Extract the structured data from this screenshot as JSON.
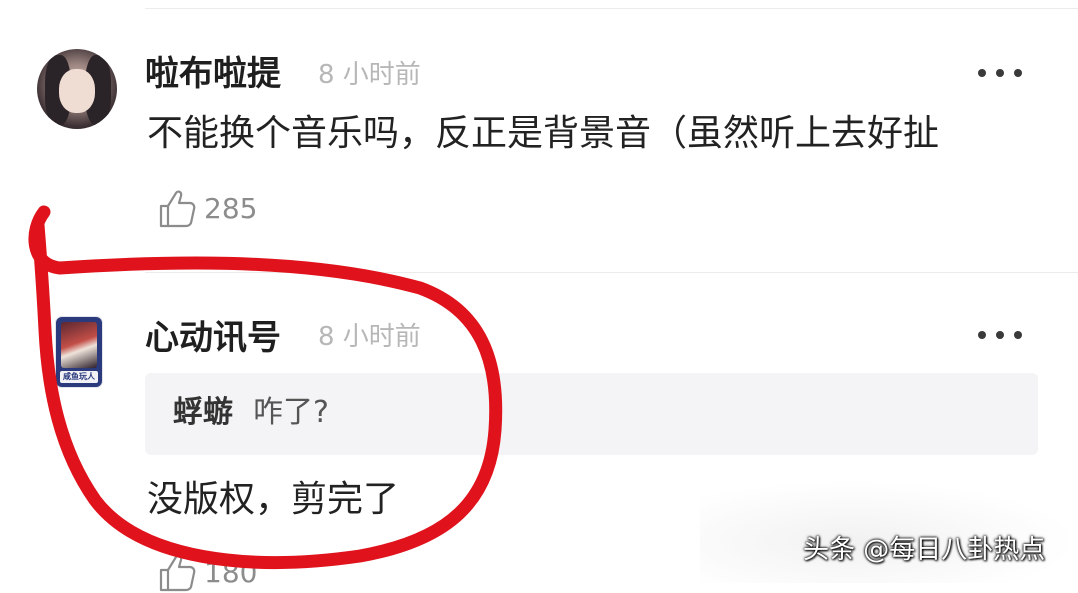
{
  "comments": [
    {
      "username": "啦布啦提",
      "time": "8 小时前",
      "text": "不能换个音乐吗，反正是背景音（虽然听上去好扯",
      "likes": "285"
    },
    {
      "username": "心动讯号",
      "time": "8 小时前",
      "avatar_caption": "咸鱼玩人",
      "quote": {
        "name": "蜉蝣",
        "text": "咋了?"
      },
      "text": "没版权，剪完了",
      "likes": "180"
    }
  ],
  "watermark": "头条 @每日八卦热点",
  "colors": {
    "annotation": "#e0121c",
    "quote_bg": "#f4f4f6",
    "timestamp": "#b7b7b7"
  }
}
